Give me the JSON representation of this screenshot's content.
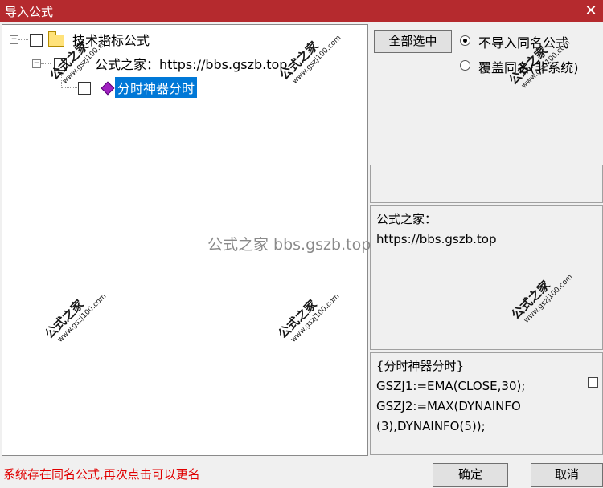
{
  "window": {
    "title": "导入公式",
    "close_glyph": "✕"
  },
  "tree": {
    "root": {
      "label": "技术指标公式",
      "expander": "−"
    },
    "child": {
      "label": "公式之家：https://bbs.gszb.top",
      "expander": "−"
    },
    "leaf": {
      "label": "分时神器分时",
      "selected": true
    }
  },
  "options": {
    "select_all_label": "全部选中",
    "radio_no_import": "不导入同名公式",
    "radio_overwrite": "覆盖同名(非系统)",
    "selected_option": "不导入同名公式"
  },
  "info_panel": {
    "text": "公式之家：\nhttps://bbs.gszb.top"
  },
  "code_panel": {
    "text": "{分时神器分时}\nGSZJ1:=EMA(CLOSE,30);\nGSZJ2:=MAX(DYNAINFO\n(3),DYNAINFO(5));"
  },
  "watermark": {
    "center_text": "公式之家 bbs.gszb.top",
    "stamp_text": "公式之家",
    "stamp_url": "www.gszj100.com"
  },
  "status_message": "系统存在同名公式,再次点击可以更名",
  "buttons": {
    "ok": "确定",
    "cancel": "取消"
  },
  "colors": {
    "title_bar": "#b52a2e",
    "selection": "#0078d7",
    "status_text": "#e00000"
  }
}
